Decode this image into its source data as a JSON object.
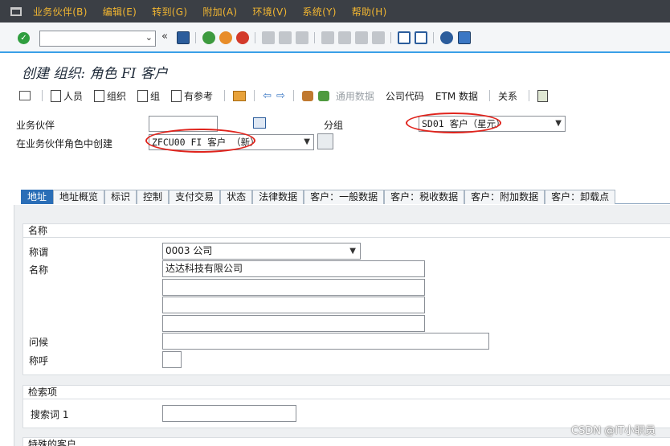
{
  "menu": [
    "业务伙伴(B)",
    "编辑(E)",
    "转到(G)",
    "附加(A)",
    "环境(V)",
    "系统(Y)",
    "帮助(H)"
  ],
  "toolbar": {
    "command_value": ""
  },
  "title": "创建 组织: 角色 FI 客户",
  "app_toolbar": {
    "person": "人员",
    "organization": "组织",
    "group": "组",
    "with_reference": "有参考",
    "general_data": "通用数据",
    "company_code": "公司代码",
    "etm_data": "ETM 数据",
    "relations": "关系"
  },
  "header": {
    "bp_label": "业务伙伴",
    "bp_value": "",
    "grouping_label": "分组",
    "grouping_value": "SD01 客户（星元）",
    "create_in_role_label": "在业务伙伴角色中创建",
    "role_value": "ZFCU00 FI 客户 （新）"
  },
  "tabs": [
    "地址",
    "地址概览",
    "标识",
    "控制",
    "支付交易",
    "状态",
    "法律数据",
    "客户：一般数据",
    "客户：税收数据",
    "客户：附加数据",
    "客户：卸载点"
  ],
  "name_group": {
    "title": "名称",
    "title_label": "称谓",
    "title_value": "0003 公司",
    "name_label": "名称",
    "name1": "达达科技有限公司",
    "name2": "",
    "name3": "",
    "name4": "",
    "greeting_label": "问候",
    "greeting_value": "",
    "salutation_label": "称呼",
    "salutation_value": ""
  },
  "search_group": {
    "title": "检索项",
    "search_term_label": "搜索词 1",
    "search_term_value": ""
  },
  "special_group": {
    "title": "特殊的客户"
  },
  "watermark": "CSDN @IT小职员",
  "colors": {
    "menubar": "#3b3f45",
    "menu_text": "#f2b631",
    "active_tab": "#2a6eb7",
    "highlight_ring": "#e0241d"
  }
}
